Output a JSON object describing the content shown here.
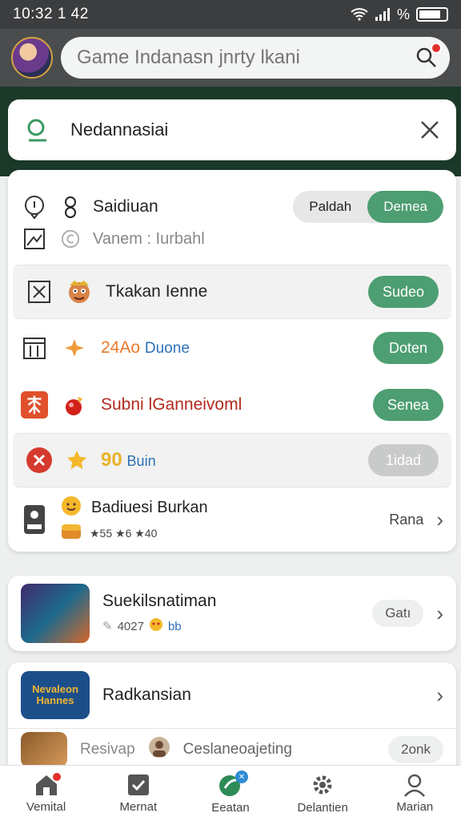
{
  "status": {
    "time": "10:32 1 42",
    "battery_text": "%"
  },
  "search": {
    "placeholder": "Game Indanasn jnrty lkani"
  },
  "top_card": {
    "title": "Nedannasiai"
  },
  "main_rows": [
    {
      "label": "Saidiuan",
      "seg_left": "Paldah",
      "seg_right": "Demea"
    },
    {
      "label": "Vanem : Iurbahl"
    },
    {
      "label": "Tkakan Ienne",
      "button": "Sudeo"
    },
    {
      "num": "24Ao",
      "label": "Duone",
      "button": "Doten"
    },
    {
      "label": "Subni lGanneivoml",
      "button": "Senea"
    },
    {
      "num": "90",
      "label": "Buin",
      "button": "1idad"
    },
    {
      "label": "Badiuesi Burkan",
      "stats": "★55 ★6 ★40",
      "action": "Rana"
    }
  ],
  "game_cards": [
    {
      "title": "Suekilsnatiman",
      "sub": "4027",
      "sub_tag": "bb",
      "action": "Gatı"
    },
    {
      "title": "Radkansian",
      "thumb_text": "Nevaleon Hannes"
    },
    {
      "label": "Resivap",
      "label2": "Ceslaneoajeting",
      "action": "2onk"
    }
  ],
  "nav": [
    {
      "label": "Vemital",
      "icon": "home-icon"
    },
    {
      "label": "Mernat",
      "icon": "check-icon"
    },
    {
      "label": "Eeatan",
      "icon": "leaf-icon"
    },
    {
      "label": "Delantien",
      "icon": "gear-icon"
    },
    {
      "label": "Marian",
      "icon": "user-icon"
    }
  ],
  "colors": {
    "accent": "#4d9e72",
    "header": "#4a4c4e",
    "badge": "#e3312d"
  }
}
